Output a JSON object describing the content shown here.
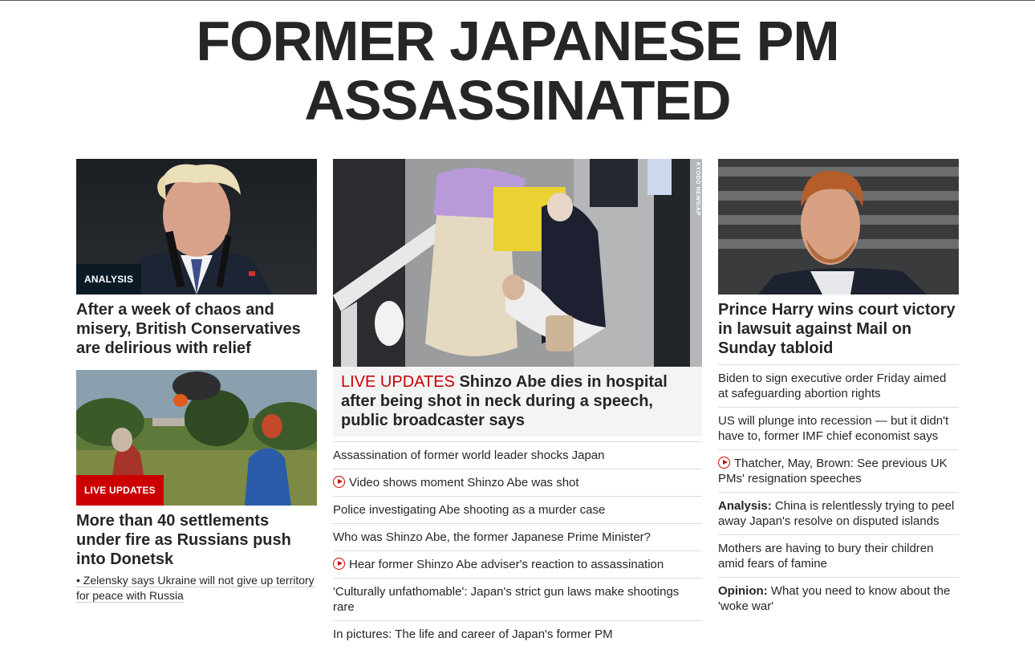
{
  "headline": {
    "line1": "FORMER JAPANESE PM",
    "line2": "ASSASSINATED"
  },
  "left": {
    "story1": {
      "badge": "ANALYSIS",
      "title": "After a week of chaos and misery, British Conservatives are delirious with relief"
    },
    "story2": {
      "badge": "LIVE UPDATES",
      "title": "More than 40 settlements under fire as Russians push into Donetsk",
      "sub": "• Zelensky says Ukraine will not give up territory for peace with Russia"
    }
  },
  "center": {
    "credit": "KYODO NEWS/AP",
    "live_label": "LIVE UPDATES",
    "hero_title": "Shinzo Abe dies in hospital after being shot in neck during a speech, public broadcaster says",
    "items": [
      {
        "text": "Assassination of former world leader shocks Japan",
        "video": false
      },
      {
        "text": "Video shows moment Shinzo Abe was shot",
        "video": true
      },
      {
        "text": "Police investigating Abe shooting as a murder case",
        "video": false
      },
      {
        "text": "Who was Shinzo Abe, the former Japanese Prime Minister?",
        "video": false
      },
      {
        "text": "Hear former Shinzo Abe adviser's reaction to assassination",
        "video": true
      },
      {
        "text": "'Culturally unfathomable': Japan's strict gun laws make shootings rare",
        "video": false
      },
      {
        "text": "In pictures: The life and career of Japan's former PM",
        "video": false
      }
    ]
  },
  "right": {
    "title": "Prince Harry wins court victory in lawsuit against Mail on Sunday tabloid",
    "items": [
      {
        "prefix": "",
        "text": "Biden to sign executive order Friday aimed at safeguarding abortion rights",
        "video": false
      },
      {
        "prefix": "",
        "text": "US will plunge into recession — but it didn't have to, former IMF chief economist says",
        "video": false
      },
      {
        "prefix": "",
        "text": "Thatcher, May, Brown: See previous UK PMs' resignation speeches",
        "video": true
      },
      {
        "prefix": "Analysis:",
        "text": " China is relentlessly trying to peel away Japan's resolve on disputed islands",
        "video": false
      },
      {
        "prefix": "",
        "text": "Mothers are having to bury their children amid fears of famine",
        "video": false
      },
      {
        "prefix": "Opinion:",
        "text": " What you need to know about the 'woke war'",
        "video": false
      }
    ]
  },
  "icons": {
    "video": "play-circle-icon"
  },
  "colors": {
    "accent_red": "#cc0000",
    "dark_badge": "#0c1a26",
    "text": "#262626"
  }
}
